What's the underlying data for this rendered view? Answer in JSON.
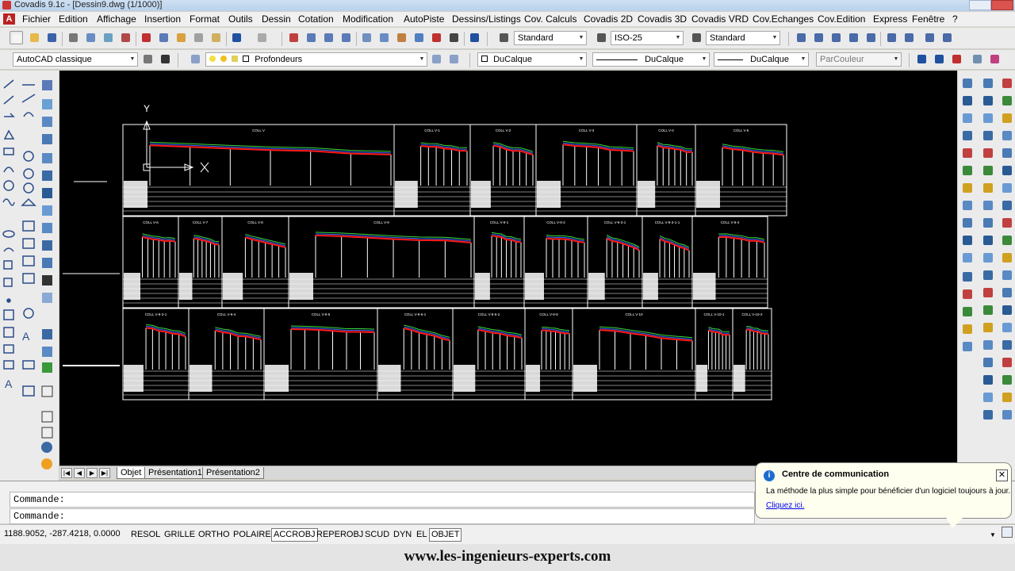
{
  "window": {
    "title": "Covadis 9.1c - [Dessin9.dwg (1/1000)]"
  },
  "menu": {
    "items": [
      "Fichier",
      "Edition",
      "Affichage",
      "Insertion",
      "Format",
      "Outils",
      "Dessin",
      "Cotation",
      "Modification",
      "AutoPiste",
      "Dessins/Listings",
      "Cov. Calculs",
      "Covadis 2D",
      "Covadis 3D",
      "Covadis VRD",
      "Cov.Echanges",
      "Cov.Edition",
      "Express",
      "Fenêtre",
      "?"
    ]
  },
  "toolbar1": {
    "text_style": "Standard",
    "dim_style": "ISO-25",
    "table_style": "Standard"
  },
  "toolbar2": {
    "workspace": "AutoCAD classique",
    "layer": "Profondeurs",
    "color": "DuCalque",
    "linetype": "DuCalque",
    "lineweight": "DuCalque",
    "plotstyle": "ParCouleur"
  },
  "drawing": {
    "row1_titles": [
      "COLL V",
      "COLL V-1",
      "COLL V-2",
      "COLL V-3",
      "COLL V-4",
      "COLL V-5"
    ],
    "row2_titles": [
      "COLL V-6",
      "COLL V-7",
      "COLL V-8",
      "COLL V-9",
      "COLL V-9-1",
      "COLL V-9-2",
      "COLL V-9-3-1",
      "COLL V-9-3-1-1",
      "COLL V-9-4"
    ],
    "row3_titles": [
      "COLL V-9-3-1",
      "COLL V-9-4",
      "COLL V-9-5",
      "COLL V-9-6-1",
      "COLL V-9-6-2",
      "COLL V-9-8",
      "COLL V-10",
      "COLL V-10-1",
      "COLL V-10-2"
    ],
    "ucs_label": "Y",
    "colors": {
      "profile": "#ff1a1a",
      "terrain_blue": "#3a6bff",
      "terrain_green": "#3bdc3b",
      "lines": "#ffffff"
    }
  },
  "tabs": {
    "items": [
      "Objet",
      "Présentation1",
      "Présentation2"
    ],
    "active": "Objet"
  },
  "command": {
    "line1": "Commande:",
    "line2": "Commande:"
  },
  "status": {
    "coords": "1188.9052, -287.4218, 0.0000",
    "buttons": [
      "RESOL",
      "GRILLE",
      "ORTHO",
      "POLAIRE",
      "ACCROBJ",
      "REPEROBJ",
      "SCUD",
      "DYN",
      "EL",
      "OBJET"
    ],
    "active": [
      "ACCROBJ",
      "OBJET"
    ]
  },
  "balloon": {
    "title": "Centre de communication",
    "text": "La méthode la plus simple pour bénéficier d'un logiciel toujours à jour.",
    "link": "Cliquez ici."
  },
  "watermark": "www.les-ingenieurs-experts.com"
}
